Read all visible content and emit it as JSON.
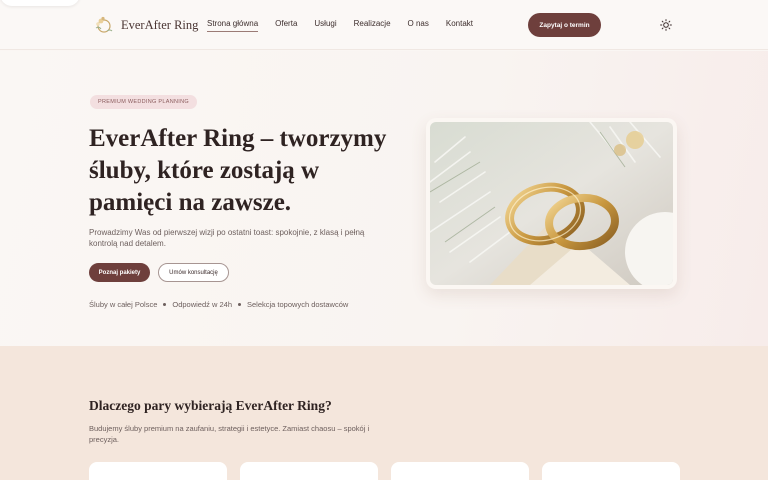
{
  "header": {
    "logo_text": "EverAfter Ring",
    "nav": [
      {
        "label": "Strona główna",
        "active": true
      },
      {
        "label": "Oferta",
        "active": false
      },
      {
        "label": "Usługi",
        "active": false
      },
      {
        "label": "Realizacje",
        "active": false
      },
      {
        "label": "O nas",
        "active": false
      },
      {
        "label": "Kontakt",
        "active": false
      }
    ],
    "cta_label": "Zapytaj o termin",
    "theme_icon": "sun-icon"
  },
  "hero": {
    "badge": "PREMIUM WEDDING PLANNING",
    "title": "EverAfter Ring – tworzymy śluby, które zostają w pamięci na zawsze.",
    "description": "Prowadzimy Was od pierwszej wizji po ostatni toast: spokojnie, z klasą i pełną kontrolą nad detalem.",
    "primary_button": "Poznaj pakiety",
    "secondary_button": "Umów konsultację",
    "features": [
      "Śluby w całej Polsce",
      "Odpowiedź w 24h",
      "Selekcja topowych dostawców"
    ],
    "image_icon": "wedding-rings-photo"
  },
  "why": {
    "title": "Dlaczego pary wybierają EverAfter Ring?",
    "description": "Budujemy śluby premium na zaufaniu, strategii i estetyce. Zamiast chaosu – spokój i precyzja."
  },
  "colors": {
    "accent": "#6e3f3c",
    "badge_bg": "#f3dfe0",
    "section_bg": "#f4e6dc"
  }
}
